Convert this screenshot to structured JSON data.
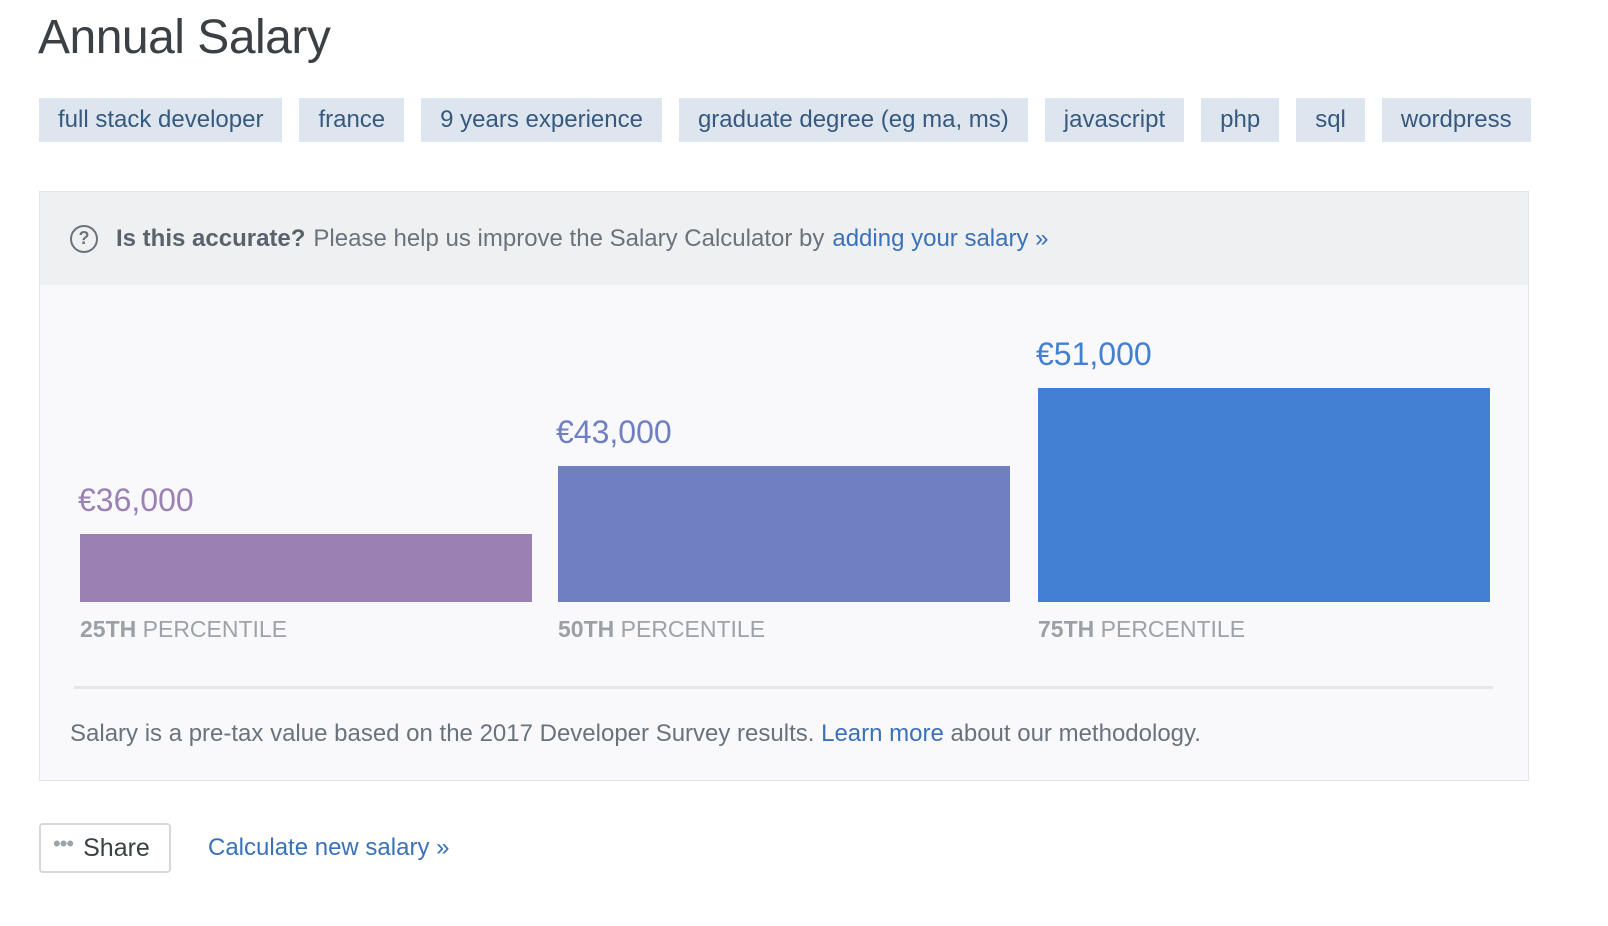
{
  "page": {
    "title": "Annual Salary"
  },
  "tags": [
    "full stack developer",
    "france",
    "9 years experience",
    "graduate degree (eg ma, ms)",
    "javascript",
    "php",
    "sql",
    "wordpress"
  ],
  "notice": {
    "icon": "question-circle-icon",
    "bold": "Is this accurate?",
    "text": "Please help us improve the Salary Calculator by",
    "link": "adding your salary »"
  },
  "chart_data": {
    "type": "bar",
    "title": "",
    "xlabel": "",
    "ylabel": "",
    "currency": "€",
    "categories": [
      "25TH PERCENTILE",
      "50TH PERCENTILE",
      "75TH PERCENTILE"
    ],
    "category_parts": [
      {
        "bold": "25TH",
        "rest": "PERCENTILE"
      },
      {
        "bold": "50TH",
        "rest": "PERCENTILE"
      },
      {
        "bold": "75TH",
        "rest": "PERCENTILE"
      }
    ],
    "values": [
      36000,
      43000,
      51000
    ],
    "labels": [
      "€36,000",
      "€43,000",
      "€51,000"
    ],
    "colors": [
      "#9b80b3",
      "#6f7fc2",
      "#437fd3"
    ],
    "grid": false,
    "legend": "none"
  },
  "footer": {
    "text_before": "Salary is a pre-tax value based on the 2017 Developer Survey results.",
    "link": "Learn more",
    "text_after": "about our methodology."
  },
  "actions": {
    "share_icon": "ellipsis-icon",
    "share_label": "Share",
    "calculate_link": "Calculate new salary »"
  }
}
